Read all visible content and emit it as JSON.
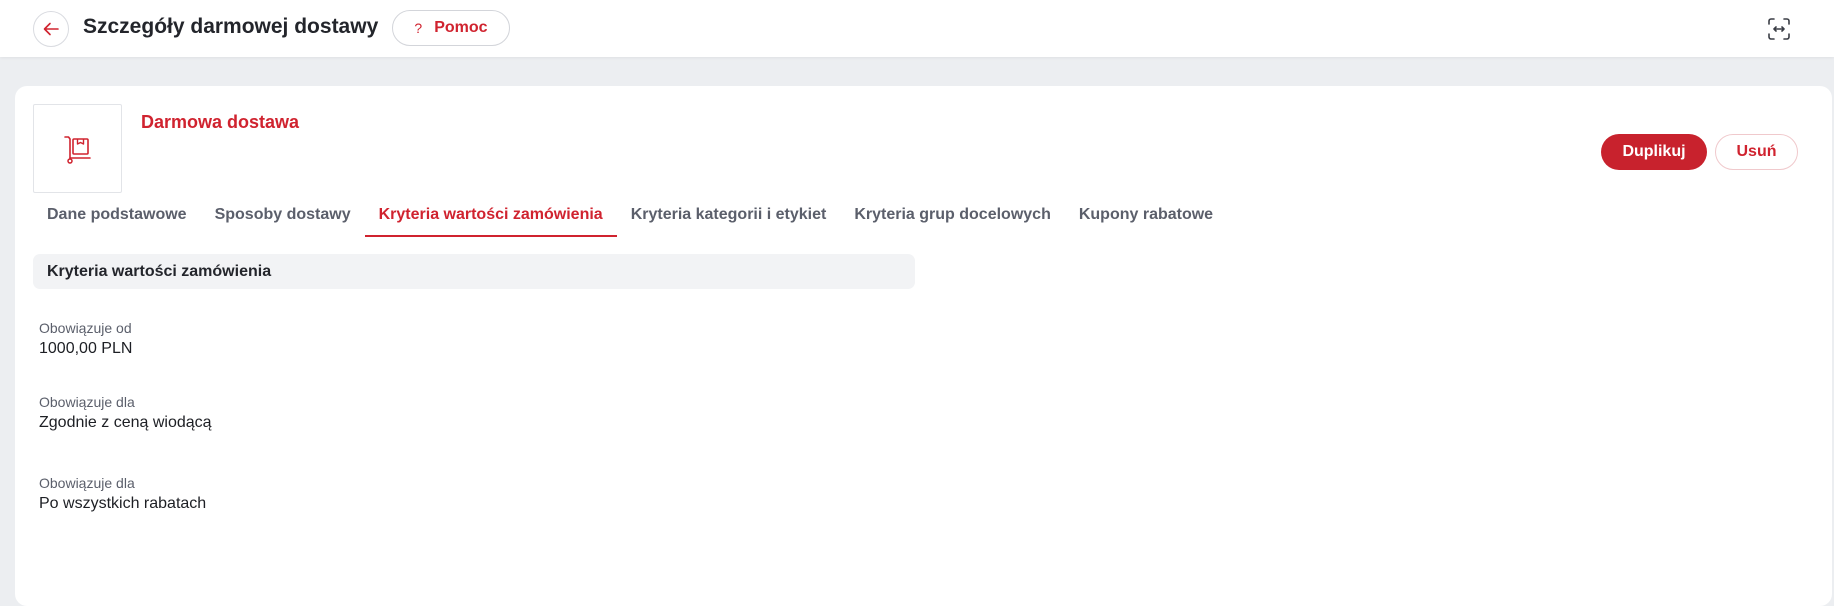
{
  "header": {
    "title": "Szczegóły darmowej dostawy",
    "help_label": "Pomoc",
    "help_icon": "?",
    "back_icon": "arrow-left-icon",
    "expand_icon": "expand-icon"
  },
  "item": {
    "name": "Darmowa dostawa",
    "thumb_icon": "delivery-cart-icon"
  },
  "actions": {
    "duplicate_label": "Duplikuj",
    "delete_label": "Usuń"
  },
  "tabs": [
    {
      "label": "Dane podstawowe"
    },
    {
      "label": "Sposoby dostawy"
    },
    {
      "label": "Kryteria wartości zamówienia"
    },
    {
      "label": "Kryteria kategorii i etykiet"
    },
    {
      "label": "Kryteria grup docelowych"
    },
    {
      "label": "Kupony rabatowe"
    }
  ],
  "active_tab": "Kryteria wartości zamówienia",
  "section": {
    "title": "Kryteria wartości zamówienia",
    "fields": [
      {
        "label": "Obowiązuje od",
        "value": "1000,00 PLN"
      },
      {
        "label": "Obowiązuje dla",
        "value": "Zgodnie z ceną wiodącą"
      },
      {
        "label": "Obowiązuje dla",
        "value": "Po wszystkich rabatach"
      }
    ]
  },
  "colors": {
    "accent": "#d0232f",
    "background": "#eceef1",
    "card": "#ffffff"
  }
}
